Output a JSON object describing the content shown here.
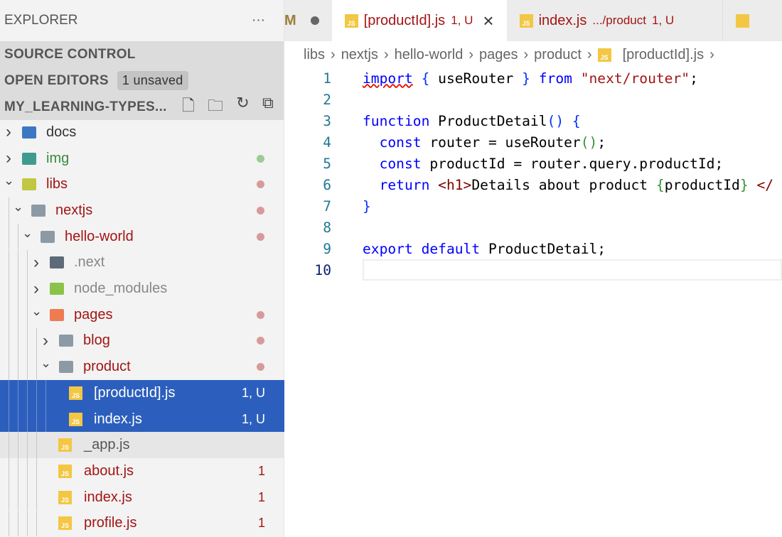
{
  "sidebar": {
    "title": "EXPLORER",
    "more": "···",
    "source_control": "SOURCE CONTROL",
    "open_editors": "OPEN EDITORS",
    "unsaved_badge": "1 unsaved",
    "workspace": "MY_LEARNING-TYPES...",
    "tree": [
      {
        "label": "docs",
        "depth": 0,
        "kind": "folder",
        "open": false,
        "color": "#333333",
        "icon_color": "#3b78c4"
      },
      {
        "label": "img",
        "depth": 0,
        "kind": "folder",
        "open": false,
        "color": "#3b8a3b",
        "icon_color": "#3f9b8f",
        "dot": "#9ccc93"
      },
      {
        "label": "libs",
        "depth": 0,
        "kind": "folder",
        "open": true,
        "color": "#a31515",
        "icon_color": "#c0c742",
        "dot": "#d79a9a"
      },
      {
        "label": "nextjs",
        "depth": 1,
        "kind": "folder",
        "open": true,
        "color": "#a31515",
        "icon_color": "#8c9aa5",
        "dot": "#d79a9a"
      },
      {
        "label": "hello-world",
        "depth": 2,
        "kind": "folder",
        "open": true,
        "color": "#a31515",
        "icon_color": "#8c9aa5",
        "dot": "#d79a9a"
      },
      {
        "label": ".next",
        "depth": 3,
        "kind": "folder",
        "open": false,
        "color": "#888888",
        "icon_color": "#5c6b77"
      },
      {
        "label": "node_modules",
        "depth": 3,
        "kind": "folder",
        "open": false,
        "color": "#888888",
        "icon_color": "#8bc34a"
      },
      {
        "label": "pages",
        "depth": 3,
        "kind": "folder",
        "open": true,
        "color": "#a31515",
        "icon_color": "#ef7b51",
        "dot": "#d79a9a"
      },
      {
        "label": "blog",
        "depth": 4,
        "kind": "folder",
        "open": false,
        "color": "#a31515",
        "icon_color": "#8c9aa5",
        "dot": "#d79a9a"
      },
      {
        "label": "product",
        "depth": 4,
        "kind": "folder",
        "open": true,
        "color": "#a31515",
        "icon_color": "#8c9aa5",
        "dot": "#d79a9a"
      },
      {
        "label": "[productId].js",
        "depth": 5,
        "kind": "js",
        "selected": true,
        "deco": "1, U"
      },
      {
        "label": "index.js",
        "depth": 5,
        "kind": "js",
        "selected": true,
        "deco": "1, U"
      },
      {
        "label": "_app.js",
        "depth": 4,
        "kind": "js",
        "hover": true,
        "color": "#555555"
      },
      {
        "label": "about.js",
        "depth": 4,
        "kind": "js",
        "color": "#a31515",
        "deco": "1"
      },
      {
        "label": "index.js",
        "depth": 4,
        "kind": "js",
        "color": "#a31515",
        "deco": "1"
      },
      {
        "label": "profile.js",
        "depth": 4,
        "kind": "js",
        "color": "#a31515",
        "deco": "1"
      }
    ]
  },
  "tabs": [
    {
      "label": "M",
      "partial": true
    },
    {
      "label": "[productId].js",
      "deco": "1, U",
      "active": true,
      "close": "×"
    },
    {
      "label": "index.js",
      "path": ".../product",
      "deco": "1, U"
    }
  ],
  "breadcrumb": [
    "libs",
    "nextjs",
    "hello-world",
    "pages",
    "product",
    "[productId].js"
  ],
  "code": [
    [
      [
        "k sq",
        "import"
      ],
      [
        "p",
        " "
      ],
      [
        "b",
        "{"
      ],
      [
        "p",
        " useRouter "
      ],
      [
        "b",
        "}"
      ],
      [
        "p",
        " "
      ],
      [
        "k",
        "from"
      ],
      [
        "p",
        " "
      ],
      [
        "s",
        "\"next/router\""
      ],
      [
        "p",
        ";"
      ]
    ],
    [],
    [
      [
        "k",
        "function"
      ],
      [
        "p",
        " ProductDetail"
      ],
      [
        "b",
        "()"
      ],
      [
        "p",
        " "
      ],
      [
        "b",
        "{"
      ]
    ],
    [
      [
        "p",
        "  "
      ],
      [
        "k",
        "const"
      ],
      [
        "p",
        " router = useRouter"
      ],
      [
        "g",
        "()"
      ],
      [
        "p",
        ";"
      ]
    ],
    [
      [
        "p",
        "  "
      ],
      [
        "k",
        "const"
      ],
      [
        "p",
        " productId = router.query.productId;"
      ]
    ],
    [
      [
        "p",
        "  "
      ],
      [
        "k",
        "return"
      ],
      [
        "p",
        " "
      ],
      [
        "t",
        "<h1>"
      ],
      [
        "p",
        "Details about product "
      ],
      [
        "g",
        "{"
      ],
      [
        "p",
        "productId"
      ],
      [
        "g",
        "}"
      ],
      [
        "p",
        " "
      ],
      [
        "t",
        "</"
      ]
    ],
    [
      [
        "b",
        "}"
      ]
    ],
    [],
    [
      [
        "k",
        "export"
      ],
      [
        "p",
        " "
      ],
      [
        "k",
        "default"
      ],
      [
        "p",
        " ProductDetail;"
      ]
    ],
    []
  ],
  "current_line": 10
}
